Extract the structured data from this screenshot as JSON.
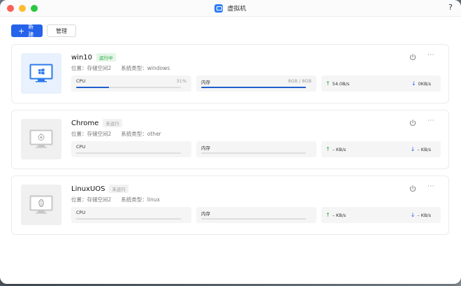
{
  "window": {
    "title": "虚拟机",
    "help": "?"
  },
  "toolbar": {
    "new_label": "新建",
    "manage_label": "管理"
  },
  "vms": [
    {
      "name": "win10",
      "status": "运行中",
      "running": true,
      "os_icon": "windows-logo-icon",
      "location": "位置：存储空间2",
      "system": "系统类型：windows",
      "cpu_label": "CPU",
      "cpu_value": "31%",
      "cpu_percent": 31,
      "mem_label": "内存",
      "mem_value": "8GB / 8GB",
      "mem_percent": 100,
      "net_up": "54.0B/s",
      "net_down": "0KB/s"
    },
    {
      "name": "Chrome",
      "status": "未运行",
      "running": false,
      "os_icon": "chrome-logo-icon",
      "location": "位置：存储空间2",
      "system": "系统类型：other",
      "cpu_label": "CPU",
      "cpu_value": "",
      "cpu_percent": 0,
      "mem_label": "内存",
      "mem_value": "",
      "mem_percent": 0,
      "net_up": "– KB/s",
      "net_down": "– KB/s"
    },
    {
      "name": "LinuxUOS",
      "status": "未运行",
      "running": false,
      "os_icon": "linux-penguin-icon",
      "location": "位置：存储空间2",
      "system": "系统类型：linux",
      "cpu_label": "CPU",
      "cpu_value": "",
      "cpu_percent": 0,
      "mem_label": "内存",
      "mem_value": "",
      "mem_percent": 0,
      "net_up": "– KB/s",
      "net_down": "– KB/s"
    }
  ],
  "colors": {
    "accent": "#2563eb",
    "running": "#27a844",
    "bar": "#1f5fcf"
  }
}
